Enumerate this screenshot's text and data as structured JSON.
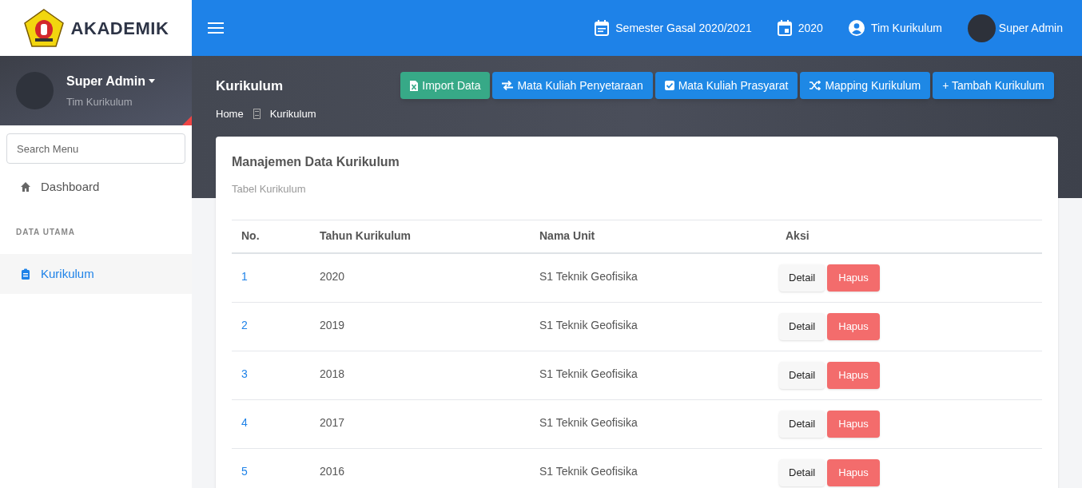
{
  "brand": {
    "name": "AKADEMIK"
  },
  "topbar": {
    "items": [
      {
        "kind": "calendar",
        "label": "Semester Gasal 2020/2021"
      },
      {
        "kind": "date",
        "label": "2020"
      },
      {
        "kind": "user",
        "label": "Tim Kurikulum"
      },
      {
        "kind": "avatar",
        "label": "Super Admin"
      }
    ]
  },
  "profile": {
    "name": "Super Admin",
    "role": "Tim Kurikulum"
  },
  "sidebar": {
    "search_placeholder": "Search Menu",
    "items": [
      {
        "kind": "home",
        "label": "Dashboard",
        "selected": false
      },
      {
        "kind": "heading",
        "label": "DATA UTAMA"
      },
      {
        "kind": "clipboard",
        "label": "Kurikulum",
        "selected": true
      }
    ]
  },
  "page": {
    "title": "Kurikulum",
    "breadcrumb": [
      "Home",
      "Kurikulum"
    ]
  },
  "actions": [
    {
      "kind": "excel",
      "label": "Import Data",
      "color": "#37a987"
    },
    {
      "kind": "swap",
      "label": "Mata Kuliah Penyetaraan",
      "color": "#1e88e5"
    },
    {
      "kind": "check",
      "label": "Mata Kuliah Prasyarat",
      "color": "#1e88e5"
    },
    {
      "kind": "shuffle",
      "label": "Mapping Kurikulum",
      "color": "#1e88e5"
    },
    {
      "kind": "plain",
      "label": "+ Tambah Kurikulum",
      "color": "#1e88e5"
    }
  ],
  "card": {
    "title": "Manajemen Data Kurikulum",
    "subtitle": "Tabel Kurikulum"
  },
  "table": {
    "columns": [
      "No.",
      "Tahun Kurikulum",
      "Nama Unit",
      "Aksi"
    ],
    "rows": [
      {
        "no": "1",
        "year": "2020",
        "unit": "S1 Teknik Geofisika",
        "buttons": [
          "Detail",
          "Hapus"
        ]
      },
      {
        "no": "2",
        "year": "2019",
        "unit": "S1 Teknik Geofisika",
        "buttons": [
          "Detail",
          "Hapus"
        ]
      },
      {
        "no": "3",
        "year": "2018",
        "unit": "S1 Teknik Geofisika",
        "buttons": [
          "Detail",
          "Hapus"
        ]
      },
      {
        "no": "4",
        "year": "2017",
        "unit": "S1 Teknik Geofisika",
        "buttons": [
          "Detail",
          "Hapus"
        ]
      },
      {
        "no": "5",
        "year": "2016",
        "unit": "S1 Teknik Geofisika",
        "buttons": [
          "Detail",
          "Hapus"
        ]
      }
    ]
  }
}
